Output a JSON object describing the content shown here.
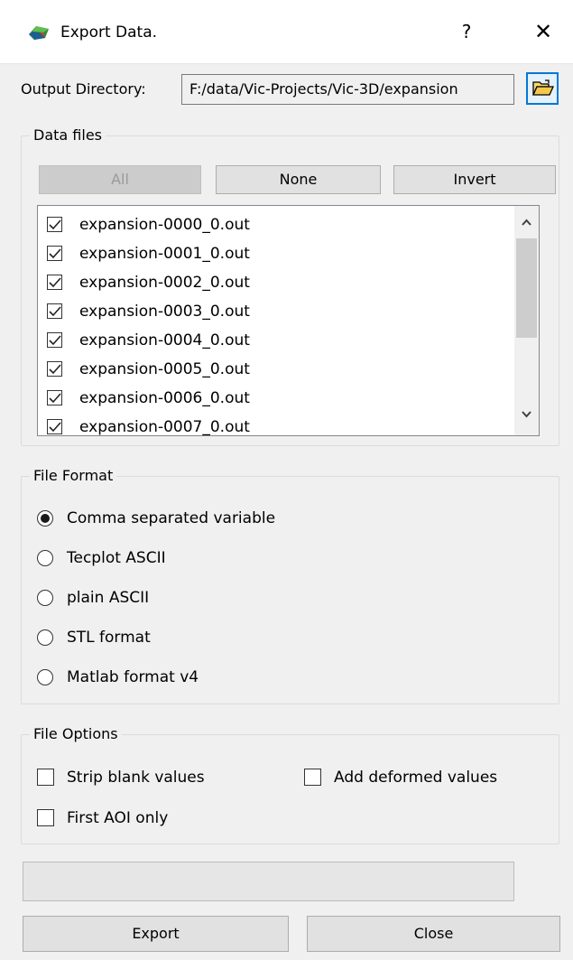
{
  "window": {
    "title": "Export Data.",
    "help_label": "?",
    "close_label": "✕"
  },
  "output_directory": {
    "label": "Output Directory:",
    "value": "F:/data/Vic-Projects/Vic-3D/expansion",
    "browse_icon": "open-folder-icon"
  },
  "data_files": {
    "group_title": "Data files",
    "buttons": {
      "all": "All",
      "none": "None",
      "invert": "Invert"
    },
    "all_enabled": false,
    "files": [
      {
        "name": "expansion-0000_0.out",
        "checked": true
      },
      {
        "name": "expansion-0001_0.out",
        "checked": true
      },
      {
        "name": "expansion-0002_0.out",
        "checked": true
      },
      {
        "name": "expansion-0003_0.out",
        "checked": true
      },
      {
        "name": "expansion-0004_0.out",
        "checked": true
      },
      {
        "name": "expansion-0005_0.out",
        "checked": true
      },
      {
        "name": "expansion-0006_0.out",
        "checked": true
      },
      {
        "name": "expansion-0007_0.out",
        "checked": true
      }
    ]
  },
  "file_format": {
    "group_title": "File Format",
    "options": [
      {
        "label": "Comma separated variable",
        "selected": true
      },
      {
        "label": "Tecplot ASCII",
        "selected": false
      },
      {
        "label": "plain ASCII",
        "selected": false
      },
      {
        "label": "STL format",
        "selected": false
      },
      {
        "label": "Matlab format v4",
        "selected": false
      }
    ]
  },
  "file_options": {
    "group_title": "File Options",
    "strip_blank": {
      "label": "Strip blank values",
      "checked": false
    },
    "add_deformed": {
      "label": "Add deformed values",
      "checked": false
    },
    "first_aoi": {
      "label": "First AOI only",
      "checked": false
    }
  },
  "progress": {
    "value": 0
  },
  "footer": {
    "export_label": "Export",
    "close_label": "Close"
  },
  "colors": {
    "accent": "#0078d7",
    "window_bg": "#f0f0f0",
    "progress_fill": "#06b025"
  }
}
